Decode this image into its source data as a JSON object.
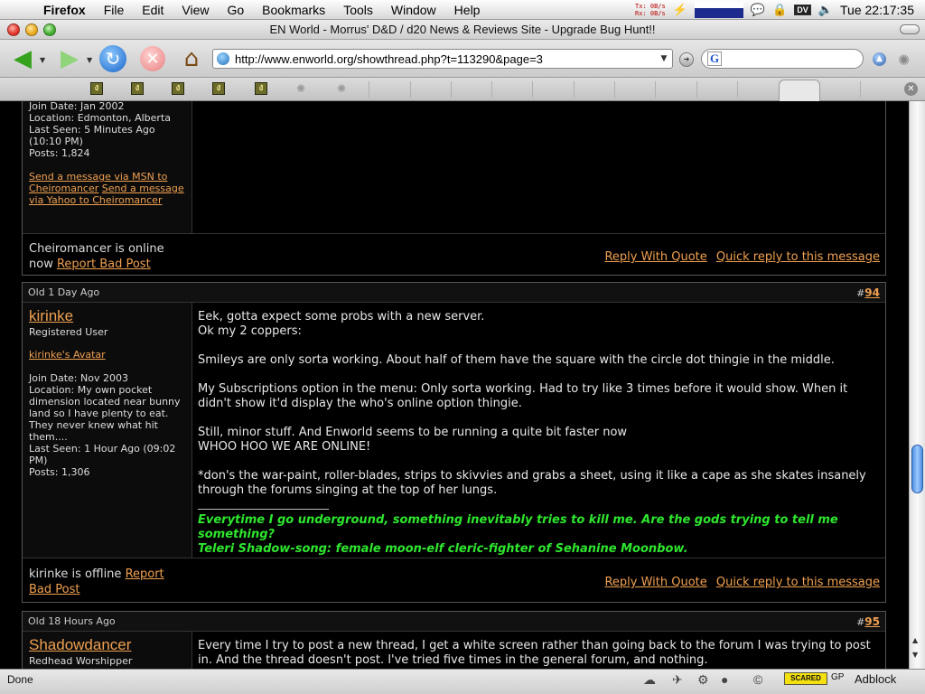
{
  "menubar": {
    "app": "Firefox",
    "items": [
      "File",
      "Edit",
      "View",
      "Go",
      "Bookmarks",
      "Tools",
      "Window",
      "Help"
    ],
    "tx_label": "Tx:",
    "tx_value": "0B/s",
    "rx_label": "Rx:",
    "rx_value": "0B/s",
    "dv": "DV",
    "clock": "Tue 22:17:35"
  },
  "window": {
    "title": "EN World - Morrus' D&D / d20 News & Reviews Site - Upgrade Bug Hunt!!"
  },
  "toolbar": {
    "url": "http://www.enworld.org/showthread.php?t=113290&page=3",
    "search_engine": "G"
  },
  "colors": {
    "link": "#f0a050",
    "signature": "#2ee62e",
    "background": "#000000"
  },
  "posts": [
    {
      "join_date": "Join Date: Jan 2002",
      "location": "Location: Edmonton, Alberta",
      "last_seen": "Last Seen: 5 Minutes Ago (10:10 PM)",
      "posts": "Posts: 1,824",
      "msn_link": "Send a message via MSN to Cheiromancer",
      "yahoo_link": "Send a message via Yahoo to Cheiromancer",
      "status": "Cheiromancer is online now",
      "report": "Report Bad Post",
      "reply_quote": "Reply With Quote",
      "quick_reply": "Quick reply to this message"
    },
    {
      "date": "1 Day Ago",
      "old_label": "Old",
      "hash": "#",
      "number": "94",
      "username": "kirinke",
      "usertitle": "Registered User",
      "avatar_link": "kirinke's Avatar",
      "join_date": "Join Date: Nov 2003",
      "location": "Location: My own pocket dimension located near bunny land so I have plenty to eat. They never knew what hit them....",
      "last_seen": "Last Seen: 1 Hour Ago (09:02 PM)",
      "posts": "Posts: 1,306",
      "body": [
        "Eek, gotta expect some probs with a new server.",
        "Ok my 2 coppers:",
        "Smileys are only sorta working. About half of them have the square with the circle dot thingie in the middle.",
        "My Subscriptions option in the menu: Only sorta working. Had to try like 3 times before it would show. When it didn't show it'd display the who's online option thingie.",
        "Still, minor stuff. And Enworld seems to be running a quite bit faster now",
        "WHOO HOO WE ARE ONLINE!",
        "*don's the war-paint, roller-blades, strips to skivvies and grabs a sheet, using it like a cape as she skates insanely through the forums singing at the top of her lungs."
      ],
      "signature": [
        "Everytime I go underground, something inevitably tries to kill me. Are the gods trying to tell me something?",
        "Teleri Shadow-song: female moon-elf cleric-fighter of Sehanine Moonbow."
      ],
      "status": "kirinke is offline",
      "report": "Report Bad Post",
      "reply_quote": "Reply With Quote",
      "quick_reply": "Quick reply to this message"
    },
    {
      "date": "18 Hours Ago",
      "old_label": "Old",
      "hash": "#",
      "number": "95",
      "username": "Shadowdancer",
      "usertitle": "Redhead Worshipper",
      "body": "Every time I try to post a new thread, I get a white screen rather than going back to the forum I was trying to post in. And the thread doesn't post. I've tried five times in the general forum, and nothing."
    }
  ],
  "status": {
    "text": "Done",
    "scared": "SCARED",
    "gp": "GP",
    "adblock": "Adblock"
  }
}
